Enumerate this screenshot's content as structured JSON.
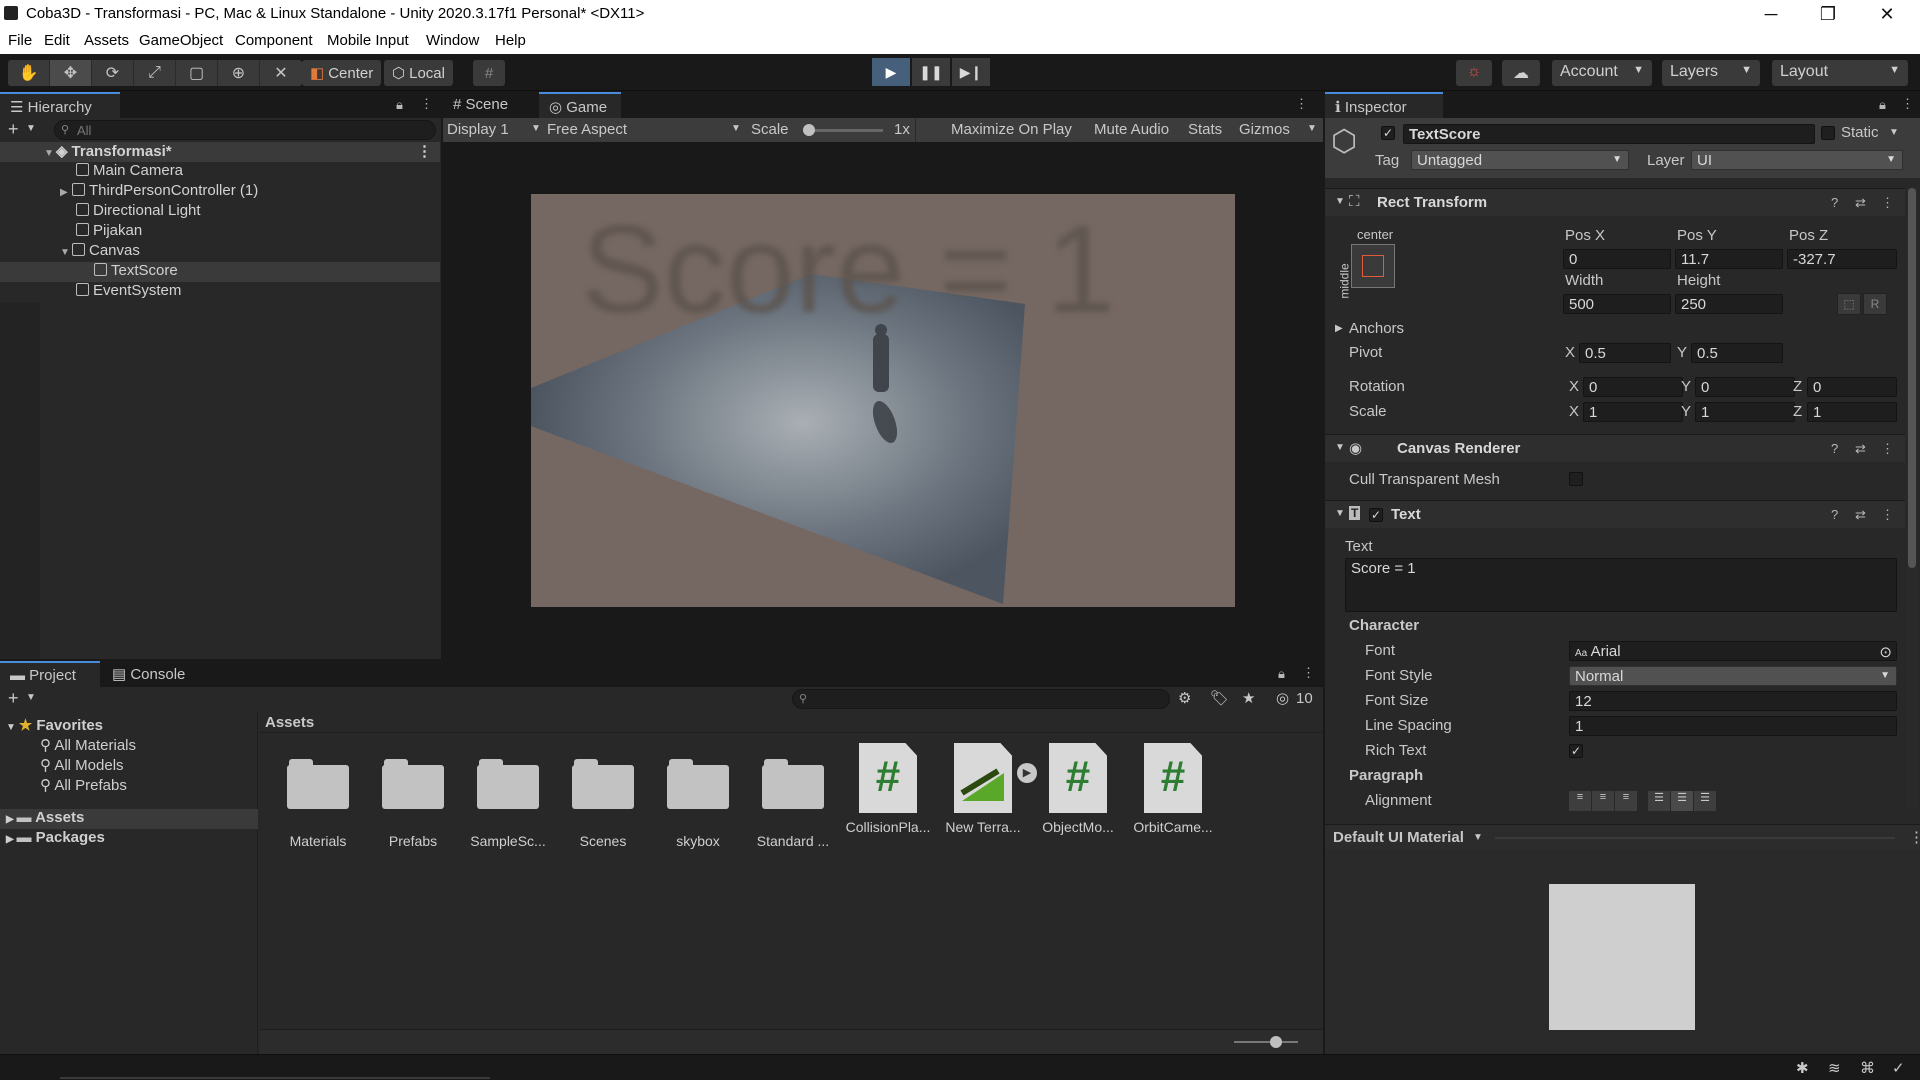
{
  "window": {
    "title": "Coba3D - Transformasi - PC, Mac & Linux Standalone - Unity 2020.3.17f1 Personal* <DX11>",
    "minimize": "─",
    "maximize": "❐",
    "close": "✕"
  },
  "menu": [
    "File",
    "Edit",
    "Assets",
    "GameObject",
    "Component",
    "Mobile Input",
    "Window",
    "Help"
  ],
  "toolbar": {
    "pivot_label": "Center",
    "space_label": "Local",
    "account_label": "Account",
    "layers_label": "Layers",
    "layout_label": "Layout"
  },
  "hierarchy": {
    "tab_label": "Hierarchy",
    "search_placeholder": "All",
    "scene_name": "Transformasi*",
    "items": [
      {
        "label": "Main Camera"
      },
      {
        "label": "ThirdPersonController (1)"
      },
      {
        "label": "Directional Light"
      },
      {
        "label": "Pijakan"
      },
      {
        "label": "Canvas"
      },
      {
        "label": "TextScore"
      },
      {
        "label": "EventSystem"
      }
    ]
  },
  "gamepanel": {
    "scene_tab": "Scene",
    "game_tab": "Game",
    "display": "Display 1",
    "aspect": "Free Aspect",
    "scale_label": "Scale",
    "scale_value": "1x",
    "scale_fraction": 0.0,
    "maximize_on_play": "Maximize On Play",
    "mute_audio": "Mute Audio",
    "stats": "Stats",
    "gizmos": "Gizmos",
    "score_text": "Score = 1"
  },
  "project": {
    "project_tab": "Project",
    "console_tab": "Console",
    "hidden_count": "10",
    "favorites_label": "Favorites",
    "favorites": [
      "All Materials",
      "All Models",
      "All Prefabs"
    ],
    "assets_root": "Assets",
    "packages_root": "Packages",
    "breadcrumb": "Assets",
    "assets": [
      {
        "label": "Materials",
        "kind": "folder"
      },
      {
        "label": "Prefabs",
        "kind": "folder"
      },
      {
        "label": "SampleSc...",
        "kind": "folder"
      },
      {
        "label": "Scenes",
        "kind": "folder"
      },
      {
        "label": "skybox",
        "kind": "folder"
      },
      {
        "label": "Standard ...",
        "kind": "folder"
      },
      {
        "label": "CollisionPla...",
        "kind": "script"
      },
      {
        "label": "New Terra...",
        "kind": "terrain"
      },
      {
        "label": "ObjectMo...",
        "kind": "script"
      },
      {
        "label": "OrbitCame...",
        "kind": "script"
      }
    ]
  },
  "inspector": {
    "tab_label": "Inspector",
    "object_name": "TextScore",
    "static_label": "Static",
    "tag_label": "Tag",
    "tag_value": "Untagged",
    "layer_label": "Layer",
    "layer_value": "UI",
    "rect_transform": {
      "title": "Rect Transform",
      "anchor_h": "center",
      "anchor_v": "middle",
      "posx_label": "Pos X",
      "posy_label": "Pos Y",
      "posz_label": "Pos Z",
      "posx": "0",
      "posy": "11.7",
      "posz": "-327.7",
      "width_label": "Width",
      "height_label": "Height",
      "width": "500",
      "height": "250",
      "r_button": "R",
      "anchors_label": "Anchors",
      "pivot_label": "Pivot",
      "pivot_x": "0.5",
      "pivot_y": "0.5",
      "rotation_label": "Rotation",
      "rot_x": "0",
      "rot_y": "0",
      "rot_z": "0",
      "scale_label": "Scale",
      "scale_x": "1",
      "scale_y": "1",
      "scale_z": "1",
      "x": "X",
      "y": "Y",
      "z": "Z"
    },
    "canvas_renderer": {
      "title": "Canvas Renderer",
      "cull_label": "Cull Transparent Mesh"
    },
    "text": {
      "title": "Text",
      "text_label": "Text",
      "text_value": "Score = 1",
      "character_label": "Character",
      "font_label": "Font",
      "font_value": "Arial",
      "font_prefix": "Aa",
      "font_style_label": "Font Style",
      "font_style_value": "Normal",
      "font_size_label": "Font Size",
      "font_size_value": "12",
      "line_spacing_label": "Line Spacing",
      "line_spacing_value": "1",
      "rich_text_label": "Rich Text",
      "paragraph_label": "Paragraph",
      "alignment_label": "Alignment"
    },
    "material_label": "Default UI Material"
  },
  "colors": {
    "accent": "#4a8bdc",
    "selection": "#2d4a6d",
    "script_green": "#2d7d32"
  }
}
